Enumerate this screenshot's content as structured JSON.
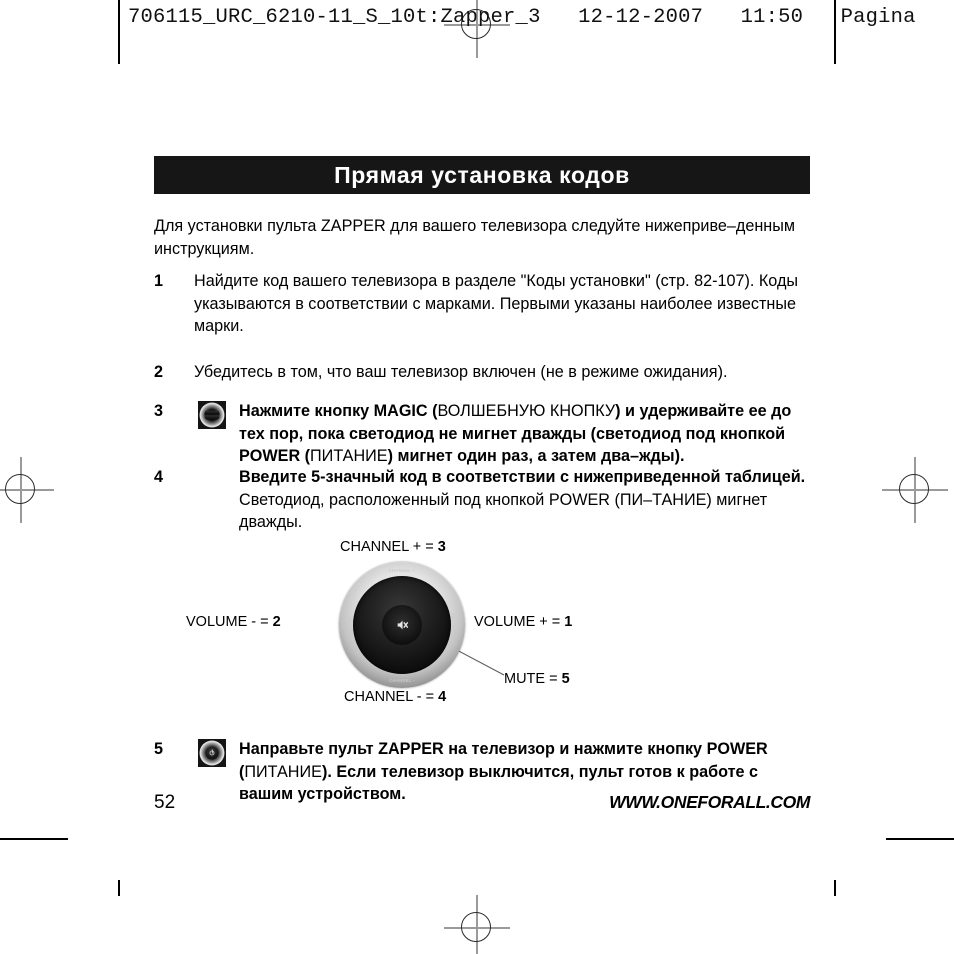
{
  "imposition": {
    "header": "706115_URC_6210-11_S_10t:Zapper_3   12-12-2007   11:50   Pagina"
  },
  "page": {
    "title": "Прямая установка кодов",
    "intro": "Для установки пульта ZAPPER для вашего телевизора следуйте нижеприве–денным инструкциям.",
    "number": "52",
    "website": "WWW.ONEFORALL.COM"
  },
  "steps": [
    {
      "num": "1",
      "text": "Найдите код вашего телевизора в разделе \"Коды установки\" (стр. 82-107). Коды указываются в соответствии с марками. Первыми указаны наиболее известные марки."
    },
    {
      "num": "2",
      "text": "Убедитесь в том, что ваш телевизор включен (не в режиме ожидания)."
    },
    {
      "num": "3",
      "icon": "magic-button-icon",
      "parts": [
        {
          "t": "Нажмите кнопку ",
          "b": true
        },
        {
          "t": "MAGIC",
          "b": true
        },
        {
          "t": " (",
          "b": true
        },
        {
          "t": "ВОЛШЕБНУЮ КНОПКУ",
          "b": false
        },
        {
          "t": ") и удерживайте ее до тех пор, пока светодиод не мигнет дважды (светодиод под кнопкой ",
          "b": true
        },
        {
          "t": "POWER",
          "b": true
        },
        {
          "t": " (",
          "b": true
        },
        {
          "t": "ПИТАНИЕ",
          "b": false
        },
        {
          "t": ") мигнет один раз, а затем два–жды).",
          "b": true
        }
      ]
    },
    {
      "num": "4",
      "parts": [
        {
          "t": "Введите 5-значный код в соответствии с нижеприведенной таблицей.",
          "b": true
        },
        {
          "t": " Светодиод, расположенный под кнопкой POWER (ПИ–ТАНИЕ) мигнет дважды.",
          "b": false
        }
      ]
    },
    {
      "num": "5",
      "icon": "power-button-icon",
      "parts": [
        {
          "t": "Направьте пульт ",
          "b": true
        },
        {
          "t": "ZAPPER",
          "b": true
        },
        {
          "t": " на телевизор и нажмите кнопку ",
          "b": true
        },
        {
          "t": "POWER",
          "b": true
        },
        {
          "t": " (",
          "b": true
        },
        {
          "t": "ПИТАНИЕ",
          "b": false
        },
        {
          "t": "). Если телевизор выключится, пульт готов к работе с вашим устройством.",
          "b": true
        }
      ]
    }
  ],
  "diagram": {
    "name": "remote-wheel-diagram",
    "labels": {
      "top": {
        "text": "CHANNEL + = ",
        "value": "3"
      },
      "left": {
        "text": "VOLUME - = ",
        "value": "2"
      },
      "right": {
        "text": "VOLUME + = ",
        "value": "1"
      },
      "bottom": {
        "text": "CHANNEL - = ",
        "value": "4"
      },
      "center": {
        "text": "MUTE = ",
        "value": "5"
      }
    },
    "ring_engravings": {
      "top": "CHANNEL +",
      "bottom": "CHANNEL -",
      "left": "VOLUME -",
      "right": "VOLUME +"
    }
  },
  "colors": {
    "banner_bg": "#161616",
    "banner_text": "#ffffff",
    "body_text": "#000000",
    "reg_mark": "#9a9a9a"
  }
}
